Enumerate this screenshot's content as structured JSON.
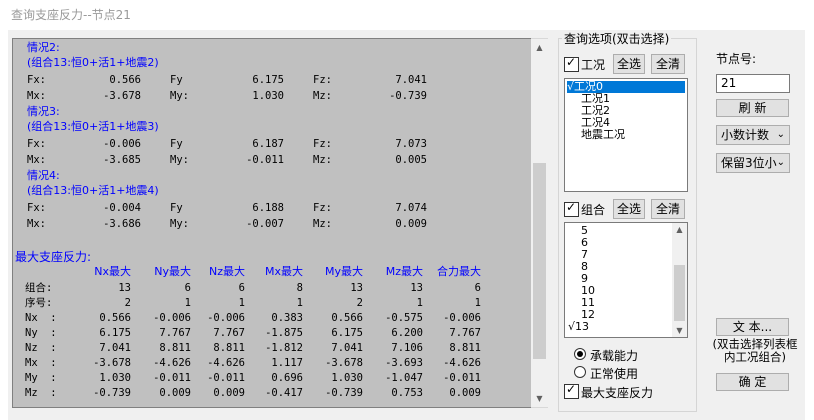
{
  "window": {
    "title": "查询支座反力--节点21"
  },
  "report": {
    "cases": [
      {
        "header": "情况2:",
        "combo": "(组合13:恒0+活1+地震2)",
        "fx": "0.566",
        "fy": "6.175",
        "fz": "7.041",
        "mx": "-3.678",
        "my": "1.030",
        "mz": "-0.739"
      },
      {
        "header": "情况3:",
        "combo": "(组合13:恒0+活1+地震3)",
        "fx": "-0.006",
        "fy": "6.187",
        "fz": "7.073",
        "mx": "-3.685",
        "my": "-0.011",
        "mz": "0.005"
      },
      {
        "header": "情况4:",
        "combo": "(组合13:恒0+活1+地震4)",
        "fx": "-0.004",
        "fy": "6.188",
        "fz": "7.074",
        "mx": "-3.686",
        "my": "-0.007",
        "mz": "0.009"
      }
    ],
    "force_labels": {
      "fx": "Fx:",
      "fy": "Fy",
      "fz": "Fz:",
      "mx": "Mx:",
      "my": "My:",
      "mz": "Mz:"
    },
    "max_title": "最大支座反力:",
    "max_headers": [
      "Nx最大",
      "Ny最大",
      "Nz最大",
      "Mx最大",
      "My最大",
      "Mz最大",
      "合力最大"
    ],
    "max_rows": [
      {
        "label": "组合:",
        "values": [
          "13",
          "6",
          "6",
          "8",
          "13",
          "13",
          "6"
        ]
      },
      {
        "label": "序号:",
        "values": [
          "2",
          "1",
          "1",
          "1",
          "2",
          "1",
          "1"
        ]
      },
      {
        "label": "Nx  :",
        "values": [
          "0.566",
          "-0.006",
          "-0.006",
          "0.383",
          "0.566",
          "-0.575",
          "-0.006"
        ]
      },
      {
        "label": "Ny  :",
        "values": [
          "6.175",
          "7.767",
          "7.767",
          "-1.875",
          "6.175",
          "6.200",
          "7.767"
        ]
      },
      {
        "label": "Nz  :",
        "values": [
          "7.041",
          "8.811",
          "8.811",
          "-1.812",
          "7.041",
          "7.106",
          "8.811"
        ]
      },
      {
        "label": "Mx  :",
        "values": [
          "-3.678",
          "-4.626",
          "-4.626",
          "1.117",
          "-3.678",
          "-3.693",
          "-4.626"
        ]
      },
      {
        "label": "My  :",
        "values": [
          "1.030",
          "-0.011",
          "-0.011",
          "0.696",
          "1.030",
          "-1.047",
          "-0.011"
        ]
      },
      {
        "label": "Mz  :",
        "values": [
          "-0.739",
          "0.009",
          "0.009",
          "-0.417",
          "-0.739",
          "0.753",
          "0.009"
        ]
      }
    ]
  },
  "options": {
    "title": "查询选项(双击选择)",
    "load_case_label": "工况",
    "load_case_checked": true,
    "select_all": "全选",
    "clear_all": "全清",
    "load_cases": [
      "√工况0",
      "工况1",
      "工况2",
      "工况4",
      "地震工况"
    ],
    "combo_label": "组合",
    "combo_checked": true,
    "combos": [
      "5",
      "6",
      "7",
      "8",
      "9",
      "10",
      "11",
      "12",
      "√13"
    ],
    "radio_bearing": "承载能力",
    "radio_normal": "正常使用",
    "max_reaction_label": "最大支座反力",
    "max_reaction_checked": true
  },
  "side": {
    "node_label": "节点号:",
    "node_value": "21",
    "refresh": "刷  新",
    "decimal_combo": "小数计数",
    "precision_combo": "保留3位小",
    "text_button": "文  本...",
    "text_note": "(双击选择列表框内工况组合)",
    "ok_button": "确  定"
  }
}
